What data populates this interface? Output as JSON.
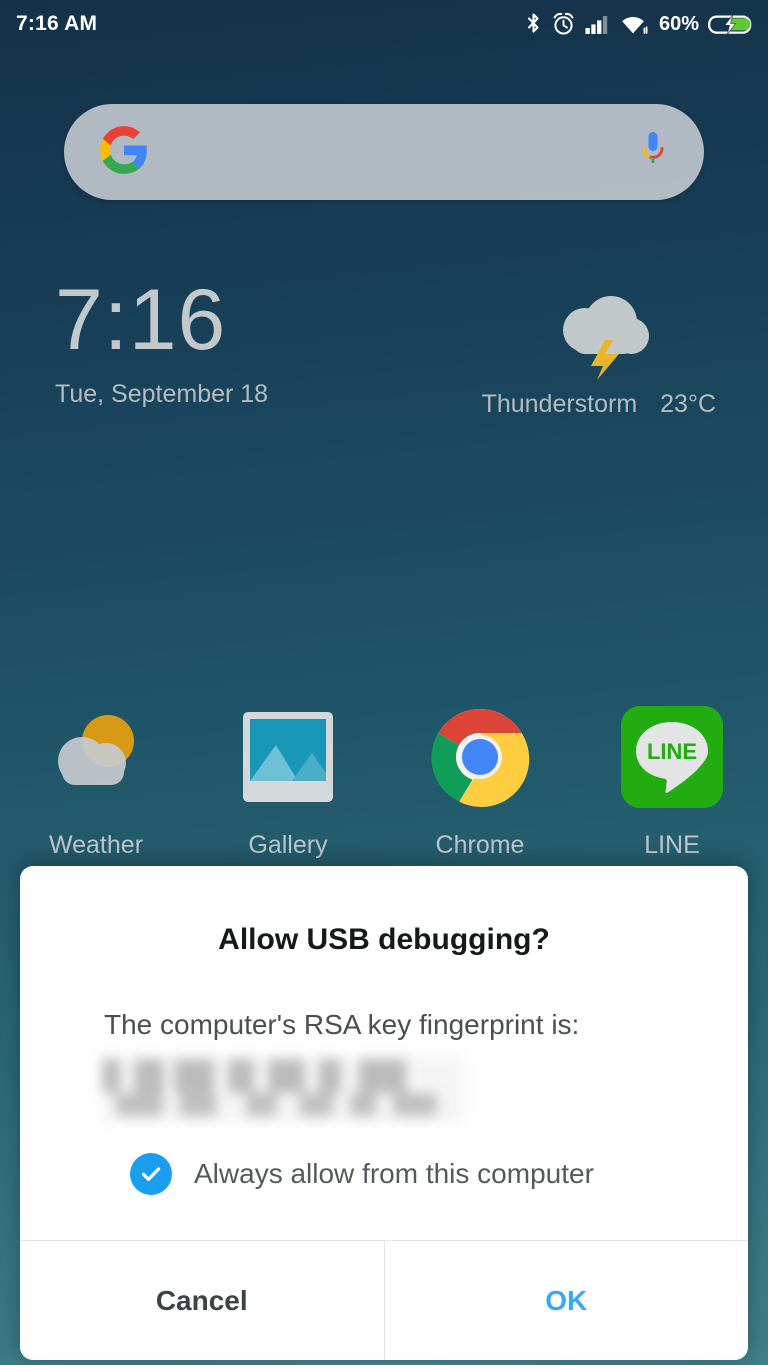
{
  "status_bar": {
    "time": "7:16 AM",
    "battery_percent": "60%",
    "icons": [
      "bluetooth-icon",
      "alarm-icon",
      "cellular-signal-icon",
      "wifi-icon",
      "battery-charging-icon"
    ]
  },
  "search_widget": {
    "logo": "google-g-icon",
    "mic": "microphone-icon",
    "placeholder": ""
  },
  "clock_widget": {
    "time": "7:16",
    "date": "Tue, September 18"
  },
  "weather_widget": {
    "icon": "thunderstorm-icon",
    "condition": "Thunderstorm",
    "temperature": "23°C"
  },
  "apps": [
    {
      "label": "Weather",
      "icon": "weather-app-icon"
    },
    {
      "label": "Gallery",
      "icon": "gallery-app-icon"
    },
    {
      "label": "Chrome",
      "icon": "chrome-app-icon"
    },
    {
      "label": "LINE",
      "icon": "line-app-icon"
    }
  ],
  "dialog": {
    "title": "Allow USB debugging?",
    "message": "The computer's RSA key fingerprint is:",
    "fingerprint_redacted": true,
    "checkbox": {
      "label": "Always allow from this computer",
      "checked": true
    },
    "cancel_label": "Cancel",
    "ok_label": "OK"
  },
  "colors": {
    "accent_blue": "#1a9ef0",
    "ok_blue": "#38a9f5",
    "battery_green": "#5ec837",
    "wallpaper_top": "#143148",
    "wallpaper_bottom": "#3c7c86"
  }
}
